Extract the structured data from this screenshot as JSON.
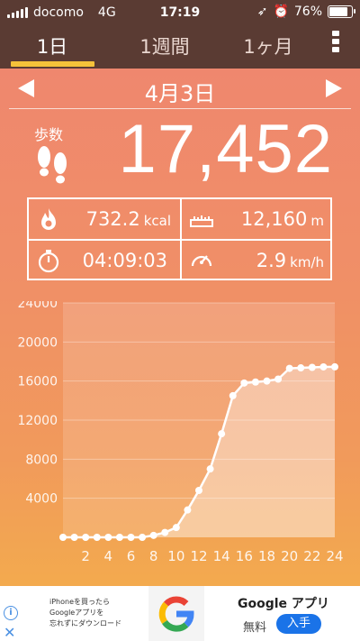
{
  "status": {
    "carrier": "docomo",
    "network": "4G",
    "time": "17:19",
    "battery": "76%"
  },
  "tabs": [
    {
      "label": "1日"
    },
    {
      "label": "1週間"
    },
    {
      "label": "1ヶ月"
    }
  ],
  "date": "4月3日",
  "steps": {
    "label": "歩数",
    "value": "17,452"
  },
  "stats": {
    "calories": {
      "value": "732.2",
      "unit": "kcal"
    },
    "distance": {
      "value": "12,160",
      "unit": "m"
    },
    "duration": {
      "value": "04:09:03"
    },
    "speed": {
      "value": "2.9",
      "unit": "km/h"
    }
  },
  "chart_data": {
    "type": "area",
    "x": [
      0,
      1,
      2,
      3,
      4,
      5,
      6,
      7,
      8,
      9,
      10,
      11,
      12,
      13,
      14,
      15,
      16,
      17,
      18,
      19,
      20,
      21,
      22,
      23,
      24
    ],
    "values": [
      0,
      0,
      0,
      0,
      0,
      0,
      0,
      0,
      200,
      500,
      1000,
      2800,
      4800,
      7000,
      10600,
      14500,
      15800,
      15900,
      16000,
      16200,
      17300,
      17350,
      17400,
      17450,
      17452
    ],
    "xticks": [
      "2",
      "4",
      "6",
      "8",
      "10",
      "12",
      "14",
      "16",
      "18",
      "20",
      "22",
      "24"
    ],
    "yticks": [
      "24000",
      "20000",
      "16000",
      "12000",
      "8000",
      "4000"
    ],
    "ylim": [
      0,
      24000
    ],
    "xlim": [
      0,
      24
    ]
  },
  "ad": {
    "text": [
      "iPhoneを買ったら",
      "Googleアプリを",
      "忘れずにダウンロード"
    ],
    "title": "Google アプリ",
    "price": "無料",
    "button": "入手"
  },
  "colors": {
    "topbar": "#5a3b33",
    "accent": "#f5c23a",
    "ad_button": "#1a73e8"
  }
}
